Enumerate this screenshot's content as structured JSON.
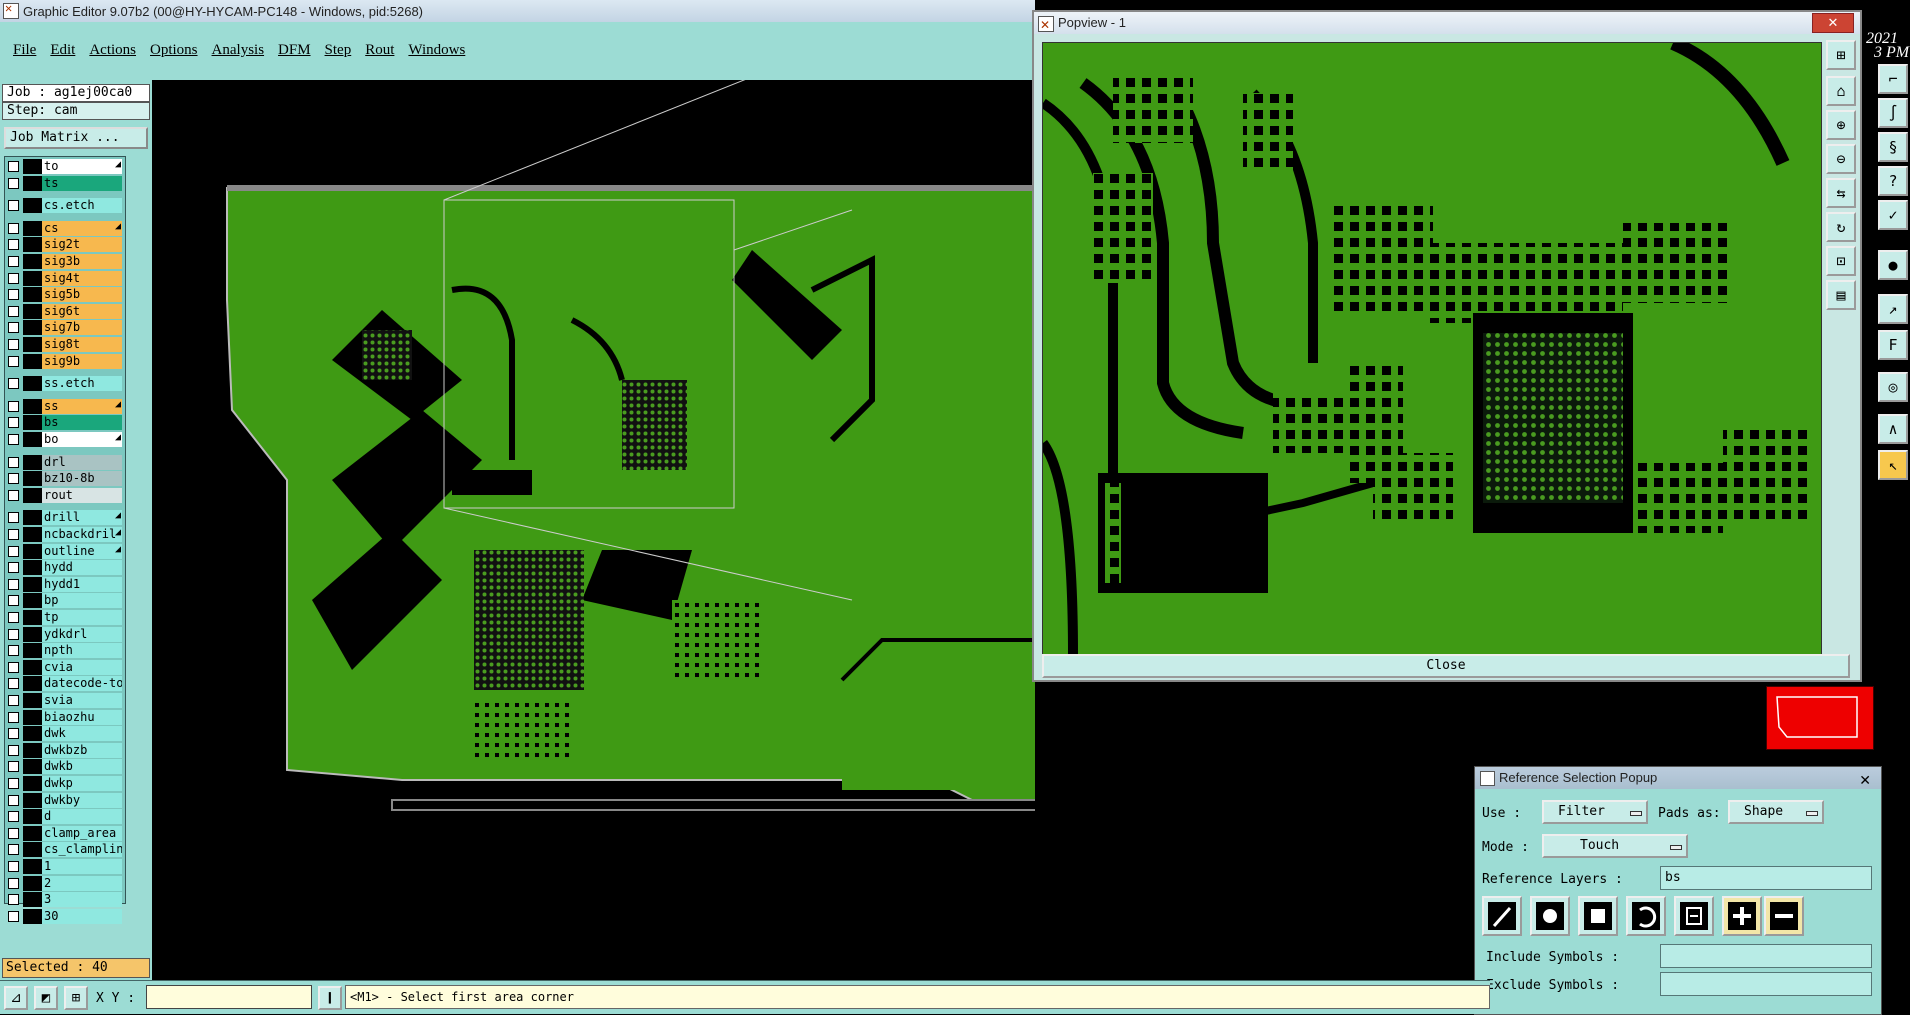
{
  "window_title": "Graphic Editor 9.07b2 (00@HY-HYCAM-PC148 - Windows, pid:5268)",
  "menu": [
    "File",
    "Edit",
    "Actions",
    "Options",
    "Analysis",
    "DFM",
    "Step",
    "Rout",
    "Windows"
  ],
  "job_label": "Job : ag1ej00ca0",
  "step_label": "Step: cam",
  "job_matrix_button": "Job Matrix ...",
  "layers": [
    {
      "name": "to",
      "color": "#ffffff",
      "arrow": true
    },
    {
      "name": "ts",
      "color": "#1aa77c",
      "arrow": false
    },
    {
      "name": "cs.etch",
      "color": "#8fe8e0",
      "arrow": false
    },
    {
      "name": "cs",
      "color": "#f7b84e",
      "arrow": true
    },
    {
      "name": "sig2t",
      "color": "#f7b84e",
      "arrow": false
    },
    {
      "name": "sig3b",
      "color": "#f7b84e",
      "arrow": false
    },
    {
      "name": "sig4t",
      "color": "#f7b84e",
      "arrow": false
    },
    {
      "name": "sig5b",
      "color": "#f7b84e",
      "arrow": false
    },
    {
      "name": "sig6t",
      "color": "#f7b84e",
      "arrow": false
    },
    {
      "name": "sig7b",
      "color": "#f7b84e",
      "arrow": false
    },
    {
      "name": "sig8t",
      "color": "#f7b84e",
      "arrow": false
    },
    {
      "name": "sig9b",
      "color": "#f7b84e",
      "arrow": false
    },
    {
      "name": "ss.etch",
      "color": "#8fe8e0",
      "arrow": false
    },
    {
      "name": "ss",
      "color": "#f7b84e",
      "arrow": true
    },
    {
      "name": "bs",
      "color": "#1aa77c",
      "arrow": false
    },
    {
      "name": "bo",
      "color": "#ffffff",
      "arrow": true
    },
    {
      "name": "drl",
      "color": "#a9c3c3",
      "arrow": false
    },
    {
      "name": "bz10-8b",
      "color": "#a9c3c3",
      "arrow": false
    },
    {
      "name": "rout",
      "color": "#d8e4e4",
      "arrow": false
    },
    {
      "name": "drill",
      "color": "#8fe8e0",
      "arrow": true
    },
    {
      "name": "ncbackdril",
      "color": "#8fe8e0",
      "arrow": true
    },
    {
      "name": "outline",
      "color": "#8fe8e0",
      "arrow": true
    },
    {
      "name": "hydd",
      "color": "#8fe8e0",
      "arrow": false
    },
    {
      "name": "hydd1",
      "color": "#8fe8e0",
      "arrow": false
    },
    {
      "name": "bp",
      "color": "#8fe8e0",
      "arrow": false
    },
    {
      "name": "tp",
      "color": "#8fe8e0",
      "arrow": false
    },
    {
      "name": "ydkdrl",
      "color": "#8fe8e0",
      "arrow": false
    },
    {
      "name": "npth",
      "color": "#8fe8e0",
      "arrow": false
    },
    {
      "name": "cvia",
      "color": "#8fe8e0",
      "arrow": false
    },
    {
      "name": "datecode-to",
      "color": "#8fe8e0",
      "arrow": false
    },
    {
      "name": "svia",
      "color": "#8fe8e0",
      "arrow": false
    },
    {
      "name": "biaozhu",
      "color": "#8fe8e0",
      "arrow": false
    },
    {
      "name": "dwk",
      "color": "#8fe8e0",
      "arrow": false
    },
    {
      "name": "dwkbzb",
      "color": "#8fe8e0",
      "arrow": false
    },
    {
      "name": "dwkb",
      "color": "#8fe8e0",
      "arrow": false
    },
    {
      "name": "dwkp",
      "color": "#8fe8e0",
      "arrow": false
    },
    {
      "name": "dwkby",
      "color": "#8fe8e0",
      "arrow": false
    },
    {
      "name": "d",
      "color": "#8fe8e0",
      "arrow": false
    },
    {
      "name": "clamp_area",
      "color": "#8fe8e0",
      "arrow": false
    },
    {
      "name": "cs_clamplin",
      "color": "#8fe8e0",
      "arrow": false
    },
    {
      "name": "1",
      "color": "#8fe8e0",
      "arrow": false
    },
    {
      "name": "2",
      "color": "#8fe8e0",
      "arrow": false
    },
    {
      "name": "3",
      "color": "#8fe8e0",
      "arrow": false
    },
    {
      "name": "30",
      "color": "#8fe8e0",
      "arrow": false
    }
  ],
  "selected_label": "Selected : 40",
  "xy_label": "X Y :",
  "xy_value": "",
  "status_prompt": "<M1> - Select first area corner",
  "popview": {
    "title": "Popview - 1",
    "close_label": "Close"
  },
  "clock_fragment": [
    "2021",
    "3 PM"
  ],
  "refsel": {
    "title": "Reference Selection Popup",
    "use_label": "Use  :",
    "use_value": "Filter",
    "pads_label": "Pads as:",
    "pads_value": "Shape",
    "mode_label": "Mode  :",
    "mode_value": "Touch",
    "ref_layers_label": "Reference Layers :",
    "ref_layers_value": "bs",
    "include_label": "Include Symbols :",
    "exclude_label": "Exclude Symbols :"
  },
  "colors": {
    "board": "#3f9a14",
    "copper_void": "#000000",
    "panel": "#9cdcd4",
    "accent_orange": "#f7b84e",
    "teal": "#1aa77c"
  }
}
